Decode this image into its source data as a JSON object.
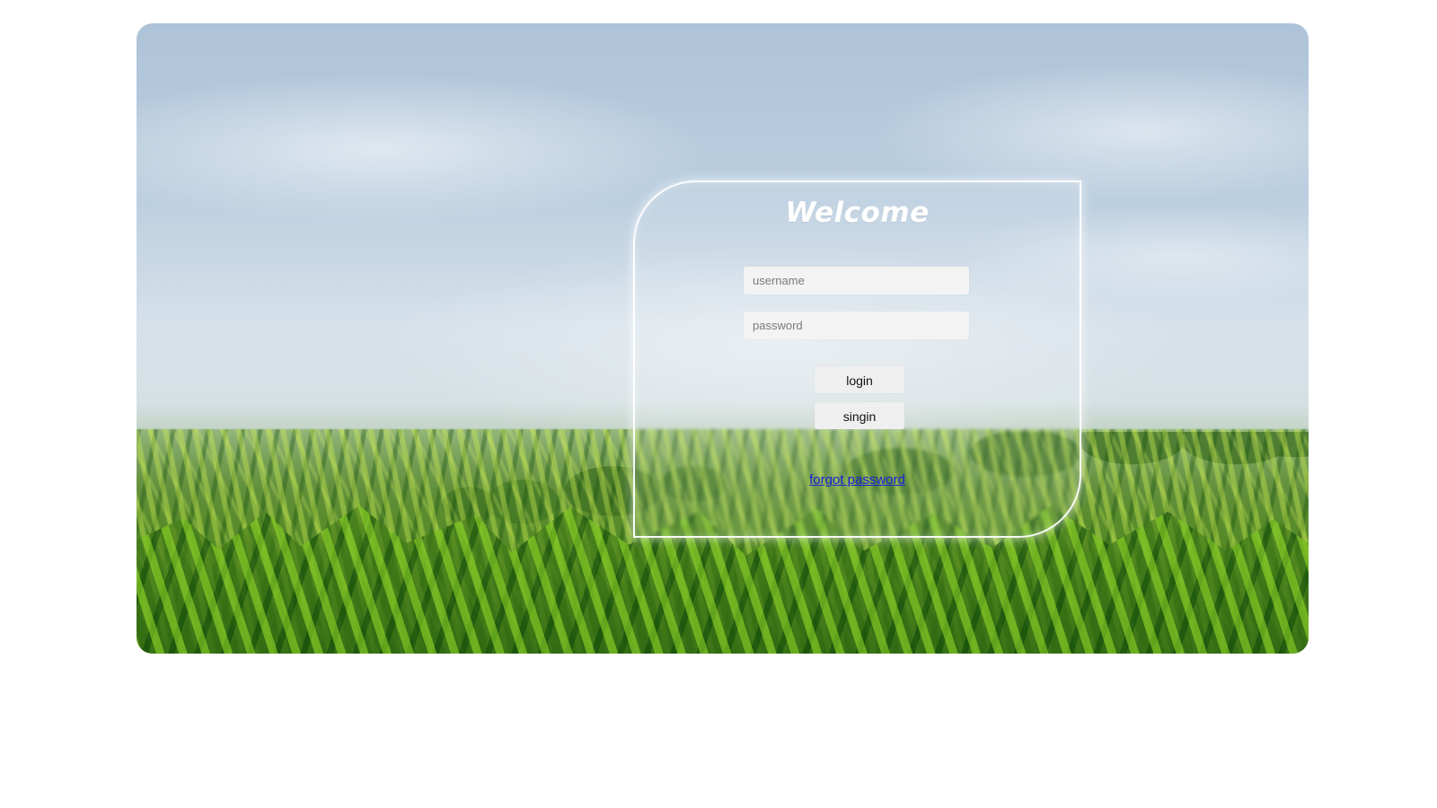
{
  "login": {
    "title": "Welcome",
    "username": {
      "value": "",
      "placeholder": "username"
    },
    "password": {
      "value": "",
      "placeholder": "password"
    },
    "login_button": "login",
    "signin_button": "singin",
    "forgot_password": "forgot password"
  }
}
